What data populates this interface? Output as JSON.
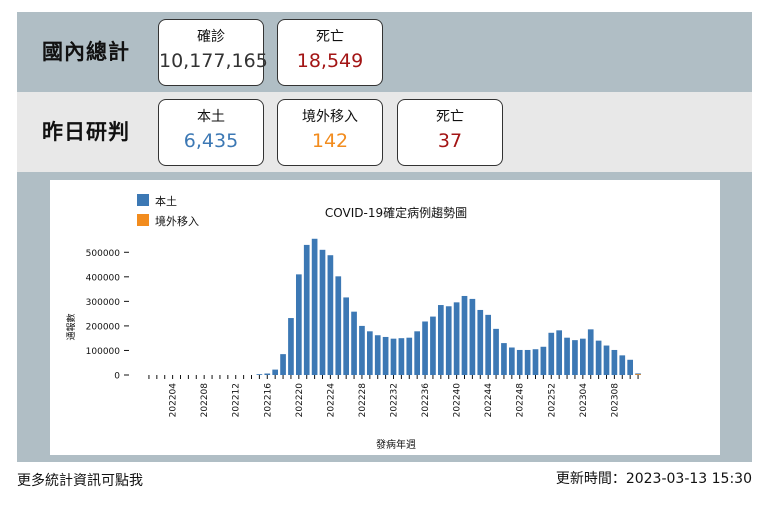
{
  "domestic_total": {
    "label": "國內總計",
    "cards": [
      {
        "label": "確診",
        "value": "10,177,165",
        "color": "#333333"
      },
      {
        "label": "死亡",
        "value": "18,549",
        "color": "#a31515"
      }
    ]
  },
  "yesterday": {
    "label": "昨日研判",
    "cards": [
      {
        "label": "本土",
        "value": "6,435",
        "color": "#3c78b4"
      },
      {
        "label": "境外移入",
        "value": "142",
        "color": "#f28c1e"
      },
      {
        "label": "死亡",
        "value": "37",
        "color": "#a31515"
      }
    ]
  },
  "footer": {
    "more_stats_link": "更多統計資訊可點我",
    "updated": "更新時間：2023-03-13 15:30"
  },
  "chart_data": {
    "type": "bar",
    "title": "COVID-19確定病例趨勢圖",
    "xlabel": "發病年週",
    "ylabel": "通報數",
    "ylim": [
      0,
      550000
    ],
    "yticks": [
      0,
      100000,
      200000,
      300000,
      400000,
      500000
    ],
    "legend": [
      "本土",
      "境外移入"
    ],
    "legend_placement": "top-left",
    "series_colors": [
      "#3c78b4",
      "#f28c1e"
    ],
    "x_tick_labels": [
      "202204",
      "202208",
      "202212",
      "202216",
      "202220",
      "202224",
      "202228",
      "202232",
      "202236",
      "202240",
      "202244",
      "202248",
      "202252",
      "202304",
      "202308"
    ],
    "x": [
      "202201",
      "202202",
      "202203",
      "202204",
      "202205",
      "202206",
      "202207",
      "202208",
      "202209",
      "202210",
      "202211",
      "202212",
      "202213",
      "202214",
      "202215",
      "202216",
      "202217",
      "202218",
      "202219",
      "202220",
      "202221",
      "202222",
      "202223",
      "202224",
      "202225",
      "202226",
      "202227",
      "202228",
      "202229",
      "202230",
      "202231",
      "202232",
      "202233",
      "202234",
      "202235",
      "202236",
      "202237",
      "202238",
      "202239",
      "202240",
      "202241",
      "202242",
      "202243",
      "202244",
      "202245",
      "202246",
      "202247",
      "202248",
      "202249",
      "202250",
      "202251",
      "202252",
      "202301",
      "202302",
      "202303",
      "202304",
      "202305",
      "202306",
      "202307",
      "202308",
      "202309",
      "202310",
      "202311"
    ],
    "series": [
      {
        "name": "本土",
        "values": [
          0,
          0,
          0,
          0,
          0,
          0,
          0,
          0,
          0,
          0,
          0,
          0,
          0,
          0,
          800,
          6000,
          22000,
          85000,
          232000,
          410000,
          530000,
          555000,
          510000,
          488000,
          402000,
          316000,
          258000,
          200000,
          178000,
          162000,
          155000,
          148000,
          150000,
          152000,
          178000,
          218000,
          238000,
          285000,
          280000,
          296000,
          322000,
          310000,
          265000,
          245000,
          188000,
          130000,
          112000,
          102000,
          102000,
          105000,
          115000,
          172000,
          182000,
          152000,
          142000,
          148000,
          186000,
          140000,
          120000,
          102000,
          80000,
          62000,
          6435
        ]
      },
      {
        "name": "境外移入",
        "values": [
          0,
          0,
          0,
          0,
          0,
          0,
          0,
          0,
          0,
          0,
          0,
          0,
          0,
          0,
          0,
          0,
          0,
          0,
          0,
          0,
          0,
          0,
          0,
          0,
          0,
          0,
          0,
          0,
          0,
          0,
          0,
          0,
          0,
          0,
          0,
          0,
          0,
          0,
          0,
          0,
          0,
          0,
          0,
          0,
          0,
          0,
          0,
          0,
          0,
          0,
          0,
          0,
          0,
          0,
          0,
          0,
          0,
          0,
          0,
          0,
          0,
          0,
          142
        ]
      }
    ]
  }
}
